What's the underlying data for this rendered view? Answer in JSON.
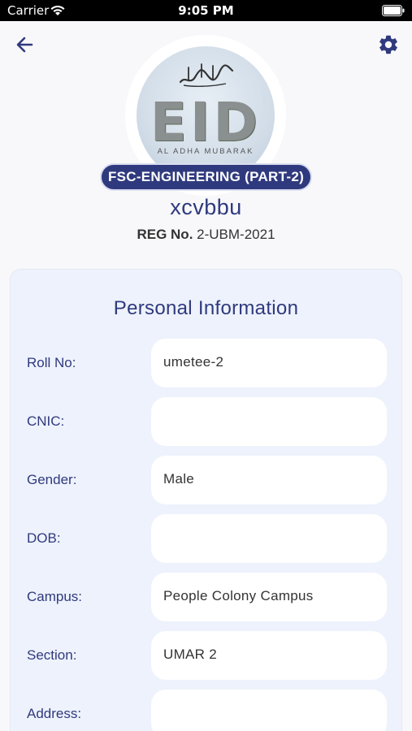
{
  "status_bar": {
    "carrier": "Carrier",
    "time": "9:05 PM"
  },
  "header": {
    "back_icon": "arrow-left-icon",
    "settings_icon": "gear-icon"
  },
  "profile": {
    "avatar_caption": "AL ADHA MUBARAK",
    "avatar_letters": "EID",
    "program": "FSC-ENGINEERING (PART-2)",
    "name": "xcvbbu",
    "reg_label": "REG No.",
    "reg_value": "2-UBM-2021"
  },
  "personal_info": {
    "title": "Personal Information",
    "fields": [
      {
        "label": "Roll No:",
        "value": "umetee-2"
      },
      {
        "label": "CNIC:",
        "value": ""
      },
      {
        "label": "Gender:",
        "value": "Male"
      },
      {
        "label": "DOB:",
        "value": ""
      },
      {
        "label": "Campus:",
        "value": "People Colony Campus"
      },
      {
        "label": "Section:",
        "value": "UMAR 2"
      },
      {
        "label": "Address:",
        "value": ""
      }
    ]
  },
  "colors": {
    "primary": "#2f3a7e",
    "card_bg": "#eef2fc",
    "page_bg": "#f8f8fa"
  }
}
